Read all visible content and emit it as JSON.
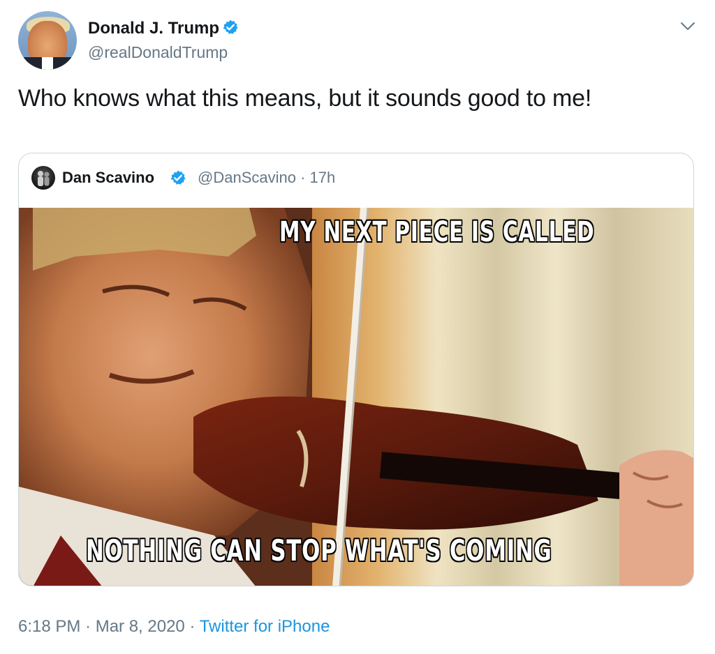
{
  "author": {
    "name": "Donald J. Trump",
    "handle": "@realDonaldTrump",
    "verified": true
  },
  "tweet": {
    "text": "Who knows what this means, but it sounds good to me!"
  },
  "quoted_tweet": {
    "name": "Dan Scavino",
    "handle_time": "@DanScavino · 17h",
    "verified": true,
    "meme": {
      "top_caption": "MY NEXT PIECE IS CALLED",
      "bottom_caption": "NOTHING CAN STOP WHAT'S COMING"
    }
  },
  "footer": {
    "timestamp": "6:18 PM · Mar 8, 2020 · ",
    "source": "Twitter for iPhone"
  },
  "colors": {
    "verified_blue": "#1da1f2",
    "link_blue": "#1b95e0",
    "secondary_text": "#657786",
    "border": "#ccd6dd"
  },
  "icons": {
    "menu": "chevron-down-icon",
    "verified": "verified-badge-icon"
  }
}
